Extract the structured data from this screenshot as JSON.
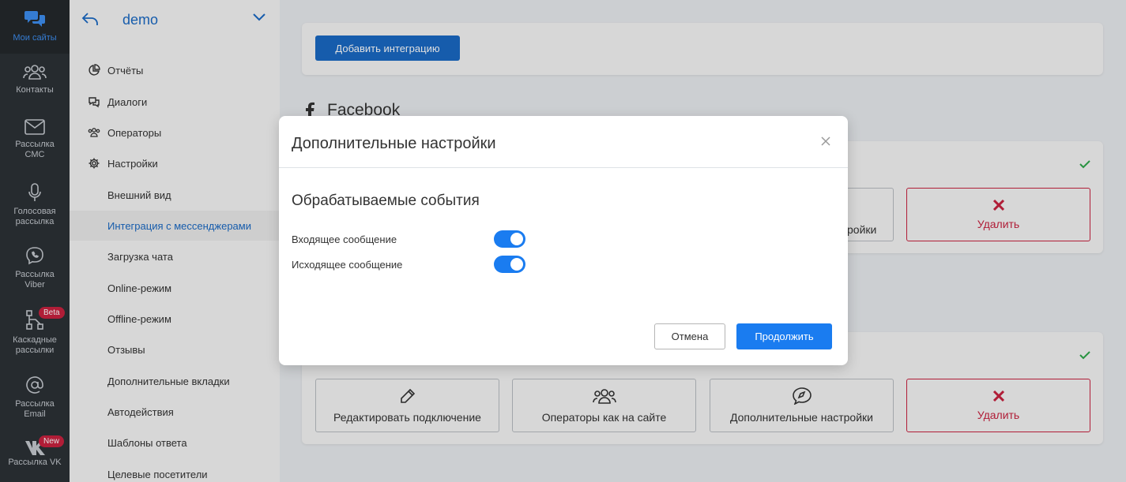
{
  "rail": {
    "items": [
      {
        "label": "Мои сайты",
        "icon": "chat-bubbles-icon"
      },
      {
        "label": "Контакты",
        "icon": "people-icon"
      },
      {
        "label": "Рассылка СМС",
        "icon": "envelope-icon"
      },
      {
        "label": "Голосовая рассылка",
        "icon": "microphone-icon"
      },
      {
        "label": "Рассылка Viber",
        "icon": "viber-icon"
      },
      {
        "label": "Каскадные рассылки",
        "icon": "cascade-icon",
        "badge": "Beta"
      },
      {
        "label": "Рассылка Email",
        "icon": "at-sign-icon"
      },
      {
        "label": "Рассылка VK",
        "icon": "vk-icon",
        "badge": "New"
      }
    ]
  },
  "sidebar": {
    "site_name": "demo",
    "items": [
      {
        "label": "Отчёты",
        "icon": "pie-chart-icon"
      },
      {
        "label": "Диалоги",
        "icon": "dialogs-icon"
      },
      {
        "label": "Операторы",
        "icon": "operators-icon"
      },
      {
        "label": "Настройки",
        "icon": "gear-icon"
      }
    ],
    "settings_items": [
      "Внешний вид",
      "Интеграция с мессенджерами",
      "Загрузка чата",
      "Online-режим",
      "Offline-режим",
      "Отзывы",
      "Дополнительные вкладки",
      "Автодействия",
      "Шаблоны ответа",
      "Целевые посетители"
    ],
    "active_settings_item": "Интеграция с мессенджерами"
  },
  "main": {
    "add_integration_label": "Добавить интеграцию",
    "facebook_title": "Facebook",
    "card_actions": {
      "edit": "Редактировать подключение",
      "operators": "Операторы как на сайте",
      "extra_settings": "Дополнительные настройки",
      "extra_settings_partial": "ройки",
      "delete": "Удалить"
    }
  },
  "modal": {
    "title": "Дополнительные настройки",
    "section_title": "Обрабатываемые события",
    "toggles": [
      {
        "label": "Входящее сообщение",
        "on": true
      },
      {
        "label": "Исходящее сообщение",
        "on": true
      }
    ],
    "cancel_label": "Отмена",
    "continue_label": "Продолжить"
  },
  "colors": {
    "accent": "#1a7cf0",
    "brand_blue": "#1a69c4",
    "danger": "#c9213f",
    "success": "#2ea84a",
    "rail_bg": "#2c3136"
  }
}
